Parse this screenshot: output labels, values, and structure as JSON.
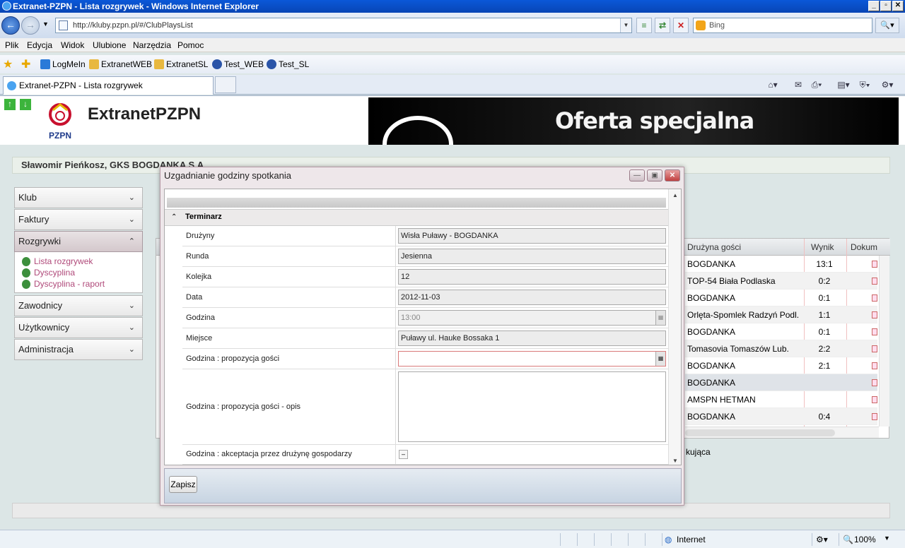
{
  "window": {
    "title": "Extranet-PZPN - Lista rozgrywek - Windows Internet Explorer"
  },
  "address": {
    "url": "http://kluby.pzpn.pl/#/ClubPlaysList"
  },
  "search": {
    "placeholder": "Bing"
  },
  "menu": [
    "Plik",
    "Edycja",
    "Widok",
    "Ulubione",
    "Narzędzia",
    "Pomoc"
  ],
  "favorites": [
    "LogMeIn",
    "ExtranetWEB",
    "ExtranetSL",
    "Test_WEB",
    "Test_SL"
  ],
  "tab": {
    "label": "Extranet-PZPN - Lista rozgrywek"
  },
  "header": {
    "brand": "ExtranetPZPN",
    "logo_text": "PZPN",
    "banner_text": "Oferta specjalna"
  },
  "user": {
    "label": "Sławomir Pieńkosz, GKS BOGDANKA S.A."
  },
  "nav": [
    {
      "label": "Klub"
    },
    {
      "label": "Faktury"
    },
    {
      "label": "Rozgrywki"
    },
    {
      "label": "Zawodnicy"
    },
    {
      "label": "Użytkownicy"
    },
    {
      "label": "Administracja"
    }
  ],
  "subnav": [
    "Lista rozgrywek",
    "Dyscyplina",
    "Dyscyplina - raport"
  ],
  "grid": {
    "headers": {
      "guest": "Drużyna gości",
      "result": "Wynik",
      "docs": "Dokum"
    },
    "rows": [
      {
        "team": "BOGDANKA",
        "result": "13:1"
      },
      {
        "team": "TOP-54 Biała Podlaska",
        "result": "0:2"
      },
      {
        "team": "BOGDANKA",
        "result": "0:1"
      },
      {
        "team": "Orlęta-Spomlek Radzyń Podl.",
        "result": "1:1"
      },
      {
        "team": "BOGDANKA",
        "result": "0:1"
      },
      {
        "team": "Tomasovia Tomaszów Lub.",
        "result": "2:2"
      },
      {
        "team": "BOGDANKA",
        "result": "2:1"
      },
      {
        "team": "BOGDANKA",
        "result": ""
      },
      {
        "team": "AMSPN HETMAN",
        "result": ""
      },
      {
        "team": "BOGDANKA",
        "result": "0:4"
      }
    ],
    "footer": "kująca"
  },
  "modal": {
    "title": "Uzgadnianie godziny spotkania",
    "section": "Terminarz",
    "fields": {
      "druzyny": {
        "label": "Drużyny",
        "value": "Wisła Puławy - BOGDANKA"
      },
      "runda": {
        "label": "Runda",
        "value": "Jesienna"
      },
      "kolejka": {
        "label": "Kolejka",
        "value": "12"
      },
      "data": {
        "label": "Data",
        "value": "2012-11-03"
      },
      "godzina": {
        "label": "Godzina",
        "value": "13:00"
      },
      "miejsce": {
        "label": "Miejsce",
        "value": "Puławy ul. Hauke Bossaka 1"
      },
      "propozycja": {
        "label": "Godzina : propozycja gości",
        "value": ""
      },
      "opis": {
        "label": "Godzina : propozycja gości - opis",
        "value": ""
      },
      "akceptacja": {
        "label": "Godzina : akceptacja przez drużynę gospodarzy"
      }
    },
    "save_label": "Zapisz"
  },
  "status": {
    "zone": "Internet",
    "zoom": "100%"
  }
}
